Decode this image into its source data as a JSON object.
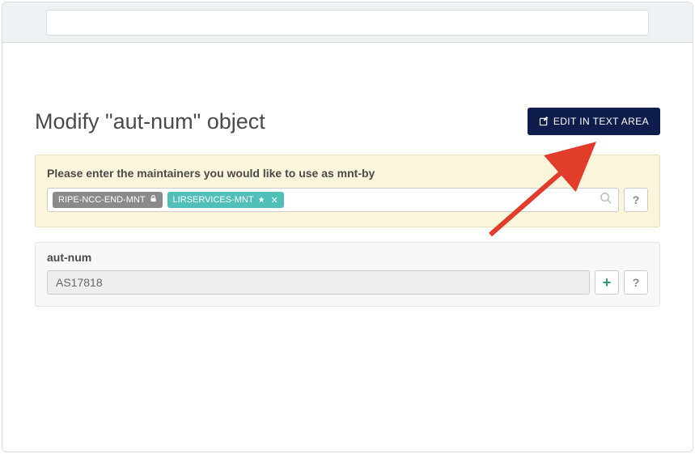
{
  "page": {
    "title": "Modify \"aut-num\" object",
    "editButton": "EDIT IN TEXT AREA"
  },
  "mntPanel": {
    "label": "Please enter the maintainers you would like to use as mnt-by",
    "tags": [
      {
        "label": "RIPE-NCC-END-MNT",
        "icon": "lock",
        "removable": false,
        "color": "grey"
      },
      {
        "label": "LIRSERVICES-MNT",
        "icon": "star",
        "removable": true,
        "color": "teal"
      }
    ],
    "helpLabel": "?"
  },
  "attr": {
    "name": "aut-num",
    "value": "AS17818",
    "plusLabel": "+",
    "helpLabel": "?"
  }
}
